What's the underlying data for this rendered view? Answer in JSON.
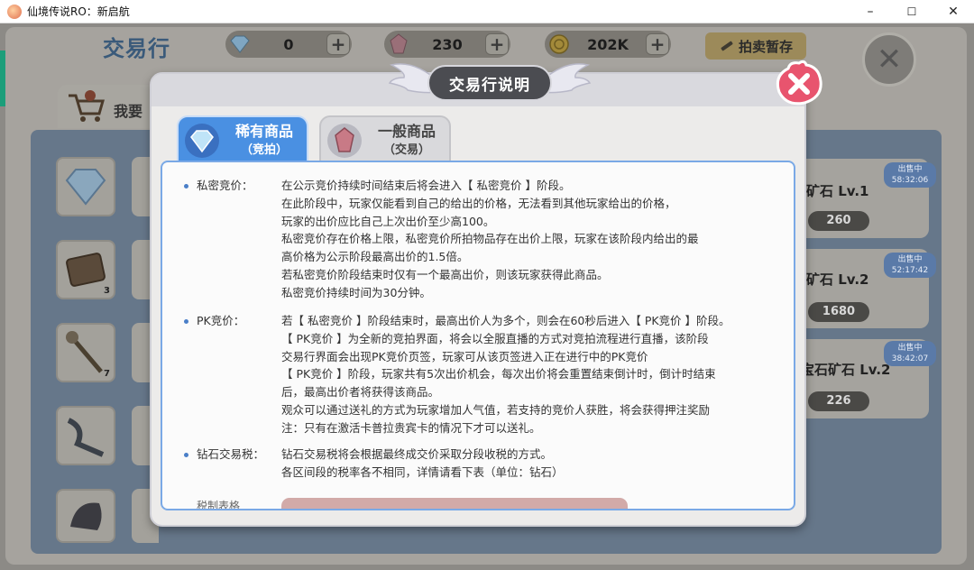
{
  "window": {
    "title": "仙境传说RO：新启航",
    "minimize": "–",
    "maximize": "☐",
    "close": "✕"
  },
  "market": {
    "title": "交易行",
    "diamond": "0",
    "gem": "230",
    "gold": "202K",
    "auction_storage": "拍卖暂存",
    "buy_tab": "我要"
  },
  "slots": [
    {
      "count": ""
    },
    {
      "count": "3"
    },
    {
      "count": "7"
    },
    {
      "count": ""
    },
    {
      "count": ""
    }
  ],
  "listings": [
    {
      "name": "矿石 Lv.1",
      "price": "260",
      "badge_label": "出售中",
      "badge_time": "58:32:06"
    },
    {
      "name": "矿石 Lv.2",
      "price": "1680",
      "badge_label": "出售中",
      "badge_time": "52:17:42"
    },
    {
      "name": "宝石矿石 Lv.2",
      "price": "226",
      "badge_label": "出售中",
      "badge_time": "38:42:07"
    }
  ],
  "modal": {
    "title": "交易行说明",
    "tabs": [
      {
        "label": "稀有商品",
        "sub": "（竞拍）",
        "active": true
      },
      {
        "label": "一般商品",
        "sub": "（交易）",
        "active": false
      }
    ],
    "sections": [
      {
        "label": "私密竞价：",
        "lines": [
          "在公示竞价持续时间结束后将会进入【 私密竞价 】阶段。",
          "在此阶段中，玩家仅能看到自己的给出的价格，无法看到其他玩家给出的价格，",
          "玩家的出价应比自己上次出价至少高100。",
          "私密竞价存在价格上限，私密竞价所拍物品存在出价上限，玩家在该阶段内给出的最",
          "高价格为公示阶段最高出价的1.5倍。",
          "若私密竞价阶段结束时仅有一个最高出价，则该玩家获得此商品。",
          "私密竞价持续时间为30分钟。"
        ]
      },
      {
        "label": "PK竞价：",
        "lines": [
          "若【 私密竞价 】阶段结束时，最高出价人为多个，则会在60秒后进入【 PK竞价 】阶段。",
          "【 PK竞价 】为全新的竞拍界面，将会以全服直播的方式对竞拍流程进行直播，该阶段",
          "交易行界面会出现PK竞价页签，玩家可从该页签进入正在进行中的PK竞价",
          "【 PK竞价 】阶段，玩家共有5次出价机会，每次出价将会重置结束倒计时，倒计时结束",
          "后，最高出价者将获得该商品。",
          "观众可以通过送礼的方式为玩家增加人气值，若支持的竞价人获胜，将会获得押注奖励",
          "注：只有在激活卡普拉贵宾卡的情况下才可以送礼。"
        ]
      },
      {
        "label": "钻石交易税：",
        "lines": [
          "钻石交易税将会根据最终成交价采取分段收税的方式。",
          "各区间段的税率各不相同，详情请看下表（单位：钻石）"
        ]
      }
    ],
    "cut_label": "税制表格"
  }
}
